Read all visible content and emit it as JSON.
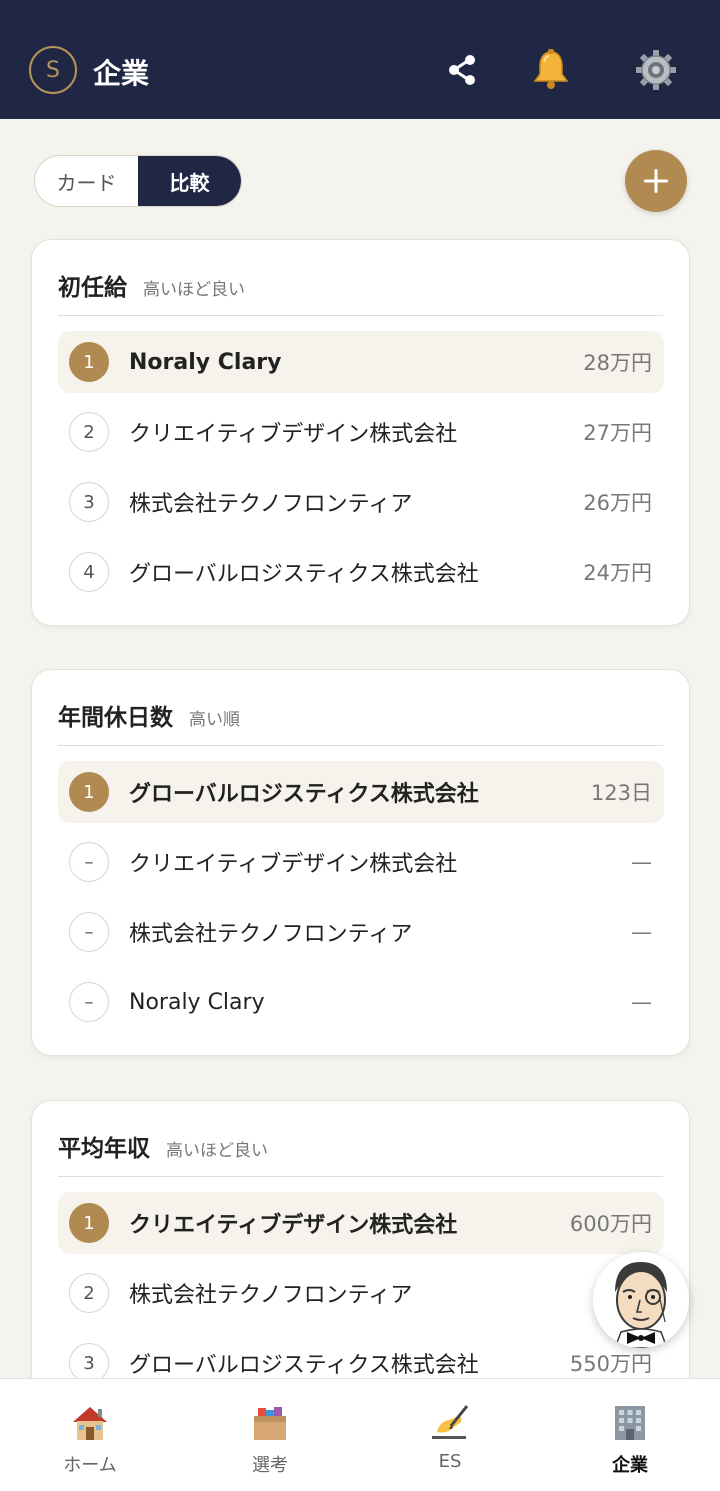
{
  "header": {
    "avatar_letter": "S",
    "title": "企業",
    "icons": [
      "share-icon",
      "bell-icon",
      "gear-icon"
    ]
  },
  "view_toggle": {
    "options": [
      "カード",
      "比較"
    ],
    "selected": "比較"
  },
  "add_button_label": "+",
  "cards": [
    {
      "title": "初任給",
      "subtitle": "高いほど良い",
      "rows": [
        {
          "rank": "1",
          "name": "Noraly Clary",
          "value": "28万円"
        },
        {
          "rank": "2",
          "name": "クリエイティブデザイン株式会社",
          "value": "27万円"
        },
        {
          "rank": "3",
          "name": "株式会社テクノフロンティア",
          "value": "26万円"
        },
        {
          "rank": "4",
          "name": "グローバルロジスティクス株式会社",
          "value": "24万円"
        }
      ]
    },
    {
      "title": "年間休日数",
      "subtitle": "高い順",
      "rows": [
        {
          "rank": "1",
          "name": "グローバルロジスティクス株式会社",
          "value": "123日"
        },
        {
          "rank": "–",
          "name": "クリエイティブデザイン株式会社",
          "value": "—"
        },
        {
          "rank": "–",
          "name": "株式会社テクノフロンティア",
          "value": "—"
        },
        {
          "rank": "–",
          "name": "Noraly Clary",
          "value": "—"
        }
      ]
    },
    {
      "title": "平均年収",
      "subtitle": "高いほど良い",
      "rows": [
        {
          "rank": "1",
          "name": "クリエイティブデザイン株式会社",
          "value": "600万円"
        },
        {
          "rank": "2",
          "name": "株式会社テクノフロンティア",
          "value": "58"
        },
        {
          "rank": "3",
          "name": "グローバルロジスティクス株式会社",
          "value": "550万円"
        }
      ]
    }
  ],
  "tabbar": [
    {
      "label": "ホーム",
      "icon": "house-icon"
    },
    {
      "label": "選考",
      "icon": "file-box-icon"
    },
    {
      "label": "ES",
      "icon": "writing-hand-icon"
    },
    {
      "label": "企業",
      "icon": "office-building-icon",
      "active": true
    }
  ],
  "colors": {
    "navy": "#1f2744",
    "gold": "#b08a50",
    "background": "#f5f3ee"
  }
}
